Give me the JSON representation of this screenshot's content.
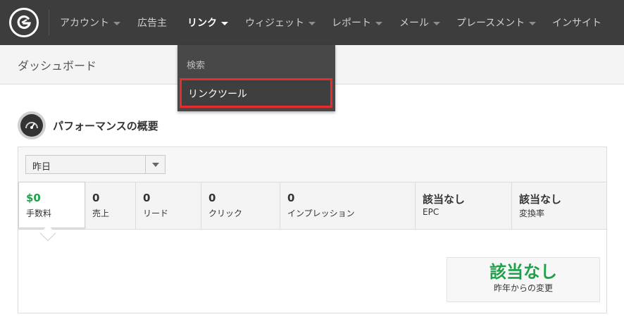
{
  "nav": {
    "items": [
      {
        "label": "アカウント",
        "caret": true
      },
      {
        "label": "広告主",
        "caret": false
      },
      {
        "label": "リンク",
        "caret": true,
        "active": true
      },
      {
        "label": "ウィジェット",
        "caret": true
      },
      {
        "label": "レポート",
        "caret": true
      },
      {
        "label": "メール",
        "caret": true
      },
      {
        "label": "プレースメント",
        "caret": true
      },
      {
        "label": "インサイト",
        "caret": false
      }
    ]
  },
  "subheader": {
    "title": "ダッシュボード"
  },
  "dropdown": {
    "section_label": "検索",
    "item_label": "リンクツール"
  },
  "section": {
    "title": "パフォーマンスの概要"
  },
  "filter": {
    "value": "昨日"
  },
  "metrics": [
    {
      "value": "$0",
      "label": "手数料"
    },
    {
      "value": "0",
      "label": "売上"
    },
    {
      "value": "0",
      "label": "リード"
    },
    {
      "value": "0",
      "label": "クリック"
    },
    {
      "value": "0",
      "label": "インプレッション"
    },
    {
      "value": "該当なし",
      "label": "EPC"
    },
    {
      "value": "該当なし",
      "label": "変換率"
    }
  ],
  "comparison": {
    "value": "該当なし",
    "label": "昨年からの変更"
  },
  "colors": {
    "nav_bg": "#3d3d3d",
    "accent_green": "#1fa14a",
    "highlight_red": "#e62c2c"
  }
}
